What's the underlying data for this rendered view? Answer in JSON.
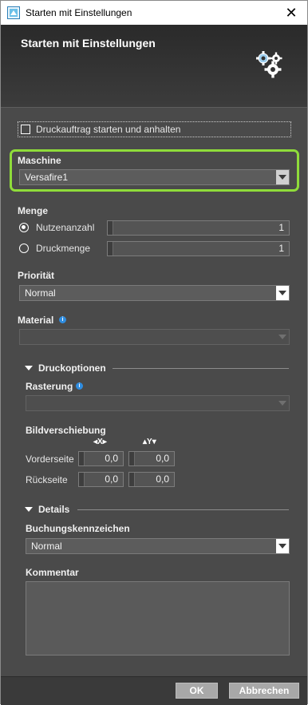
{
  "window": {
    "title": "Starten mit Einstellungen",
    "close": "✕"
  },
  "header": {
    "title": "Starten mit Einstellungen"
  },
  "hold": {
    "label": "Druckauftrag starten und anhalten",
    "checked": false
  },
  "maschine": {
    "label": "Maschine",
    "value": "Versafire1",
    "highlight_color": "#8fdc3a"
  },
  "menge": {
    "label": "Menge",
    "options": [
      {
        "label": "Nutzenanzahl",
        "value": "1",
        "selected": true
      },
      {
        "label": "Druckmenge",
        "value": "1",
        "selected": false
      }
    ]
  },
  "prioritaet": {
    "label": "Priorität",
    "value": "Normal"
  },
  "material": {
    "label": "Material",
    "value": ""
  },
  "druckoptionen": {
    "label": "Druckoptionen",
    "rasterung": {
      "label": "Rasterung",
      "value": ""
    },
    "bildverschiebung": {
      "label": "Bildverschiebung",
      "x_header": "X",
      "y_header": "Y",
      "rows": [
        {
          "label": "Vorderseite",
          "x": "0,0",
          "y": "0,0"
        },
        {
          "label": "Rückseite",
          "x": "0,0",
          "y": "0,0"
        }
      ]
    }
  },
  "details": {
    "label": "Details",
    "buchung": {
      "label": "Buchungskennzeichen",
      "value": "Normal"
    },
    "kommentar": {
      "label": "Kommentar",
      "value": ""
    }
  },
  "footer": {
    "ok": "OK",
    "cancel": "Abbrechen"
  },
  "icons": [
    "app-icon",
    "close-icon",
    "gears-icon",
    "info-icon",
    "chevron-down-icon"
  ]
}
